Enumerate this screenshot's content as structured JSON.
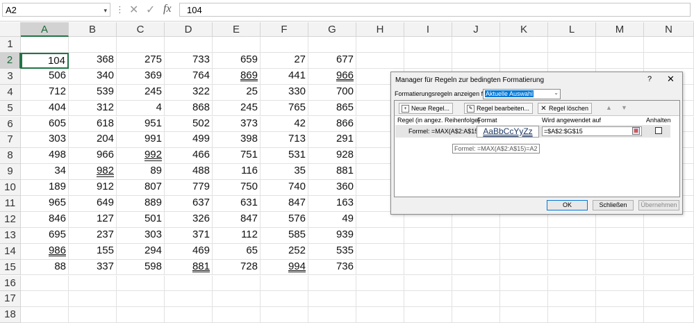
{
  "formula_bar": {
    "name_box": "A2",
    "dropdown_glyph": "▾",
    "separator": "⋮",
    "cancel_glyph": "✕",
    "enter_glyph": "✓",
    "fx_label": "fx",
    "formula": "104"
  },
  "columns": [
    "A",
    "B",
    "C",
    "D",
    "E",
    "F",
    "G",
    "H",
    "I",
    "J",
    "K",
    "L",
    "M",
    "N"
  ],
  "rows": [
    "1",
    "2",
    "3",
    "4",
    "5",
    "6",
    "7",
    "8",
    "9",
    "10",
    "11",
    "12",
    "13",
    "14",
    "15",
    "16",
    "17",
    "18"
  ],
  "cells": [
    [
      "104",
      "368",
      "275",
      "733",
      "659",
      "27",
      "677"
    ],
    [
      "506",
      "340",
      "369",
      "764",
      "869",
      "441",
      "966"
    ],
    [
      "712",
      "539",
      "245",
      "322",
      "25",
      "330",
      "700"
    ],
    [
      "404",
      "312",
      "4",
      "868",
      "245",
      "765",
      "865"
    ],
    [
      "605",
      "618",
      "951",
      "502",
      "373",
      "42",
      "866"
    ],
    [
      "303",
      "204",
      "991",
      "499",
      "398",
      "713",
      "291"
    ],
    [
      "498",
      "966",
      "992",
      "466",
      "751",
      "531",
      "928"
    ],
    [
      "34",
      "982",
      "89",
      "488",
      "116",
      "35",
      "881"
    ],
    [
      "189",
      "912",
      "807",
      "779",
      "750",
      "740",
      "360"
    ],
    [
      "965",
      "649",
      "889",
      "637",
      "631",
      "847",
      "163"
    ],
    [
      "846",
      "127",
      "501",
      "326",
      "847",
      "576",
      "49"
    ],
    [
      "695",
      "237",
      "303",
      "371",
      "112",
      "585",
      "939"
    ],
    [
      "986",
      "155",
      "294",
      "469",
      "65",
      "252",
      "535"
    ],
    [
      "88",
      "337",
      "598",
      "881",
      "728",
      "994",
      "736"
    ]
  ],
  "highlighted_cells": [
    "E3",
    "G3",
    "C8",
    "B9",
    "A14",
    "D15",
    "F15"
  ],
  "active_cell": "A2",
  "dialog": {
    "title": "Manager für Regeln zur bedingten Formatierung",
    "help": "?",
    "close": "✕",
    "show_rules_label": "Formatierungsregeln anzeigen für:",
    "show_rules_value": "Aktuelle Auswahl",
    "show_rules_dropdown": "⌄",
    "toolbar": {
      "new_rule": "Neue Regel...",
      "edit_rule": "Regel bearbeiten...",
      "delete_rule": "Regel löschen",
      "up": "▲",
      "down": "▼"
    },
    "headers": {
      "rule": "Regel (in angez. Reihenfolge)",
      "format": "Format",
      "applies_to": "Wird angewendet auf",
      "stop": "Anhalten"
    },
    "rule": {
      "formula": "Formel: =MAX(A$2:A$15...",
      "format_preview": "AaBbCcYyZz",
      "applies_to": "=$A$2:$G$15",
      "stop_checked": false
    },
    "tooltip": "Formel: =MAX(A$2:A$15)=A2",
    "buttons": {
      "ok": "OK",
      "close": "Schließen",
      "apply": "Übernehmen"
    }
  }
}
